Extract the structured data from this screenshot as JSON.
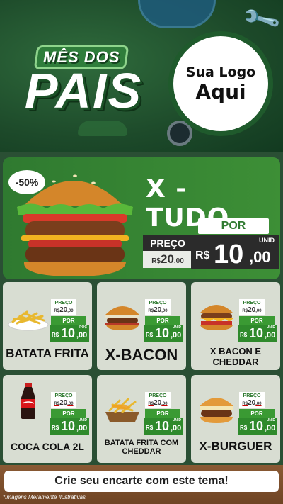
{
  "header": {
    "mes_label": "MÊS DOS",
    "title": "PAIS",
    "logo_line1": "Sua Logo",
    "logo_line2": "Aqui"
  },
  "featured": {
    "discount": "-50%",
    "name": "X - TUDO",
    "por_label": "POR",
    "preco_label": "PREÇO",
    "old_currency": "R$",
    "old_int": "20",
    "old_cents": ",00",
    "unid_label": "UNID",
    "currency": "R$",
    "price_int": "10",
    "price_cents": ",00"
  },
  "products": [
    {
      "name": "BATATA FRITA",
      "preco_label": "PREÇO",
      "old_currency": "R$",
      "old_int": "20",
      "old_cents": ",00",
      "por_label": "POR",
      "unid_label": "POÇ",
      "currency": "R$",
      "price_int": "10",
      "price_cents": ",00",
      "image": "fries-icon"
    },
    {
      "name": "X-BACON",
      "preco_label": "PREÇO",
      "old_currency": "R$",
      "old_int": "20",
      "old_cents": ",00",
      "por_label": "POR",
      "unid_label": "UNID",
      "currency": "R$",
      "price_int": "10",
      "price_cents": ",00",
      "image": "burger-icon"
    },
    {
      "name": "X BACON E CHEDDAR",
      "preco_label": "PREÇO",
      "old_currency": "R$",
      "old_int": "20",
      "old_cents": ",00",
      "por_label": "POR",
      "unid_label": "UNID",
      "currency": "R$",
      "price_int": "10",
      "price_cents": ",00",
      "image": "burger-icon"
    },
    {
      "name": "COCA COLA 2L",
      "preco_label": "PREÇO",
      "old_currency": "R$",
      "old_int": "20",
      "old_cents": ",00",
      "por_label": "POR",
      "unid_label": "UNID",
      "currency": "R$",
      "price_int": "10",
      "price_cents": ",00",
      "image": "soda-bottle-icon"
    },
    {
      "name": "BATATA FRITA COM CHEDDAR",
      "preco_label": "PREÇO",
      "old_currency": "R$",
      "old_int": "20",
      "old_cents": ",00",
      "por_label": "POR",
      "unid_label": "UNID",
      "currency": "R$",
      "price_int": "10",
      "price_cents": ",00",
      "image": "fries-cheddar-icon"
    },
    {
      "name": "X-BURGUER",
      "preco_label": "PREÇO",
      "old_currency": "R$",
      "old_int": "20",
      "old_cents": ",00",
      "por_label": "POR",
      "unid_label": "UNID",
      "currency": "R$",
      "price_int": "10",
      "price_cents": ",00",
      "image": "burger-icon"
    }
  ],
  "footer": {
    "cta": "Crie seu encarte com este tema!",
    "disclaimer": "*Imagens Meramente Ilustrativas"
  },
  "colors": {
    "brand_green": "#2f7a30",
    "dark_green_bg": "#1d4a2a",
    "price_dark": "#2b2b2b",
    "card_bg": "#d8ddd2"
  }
}
